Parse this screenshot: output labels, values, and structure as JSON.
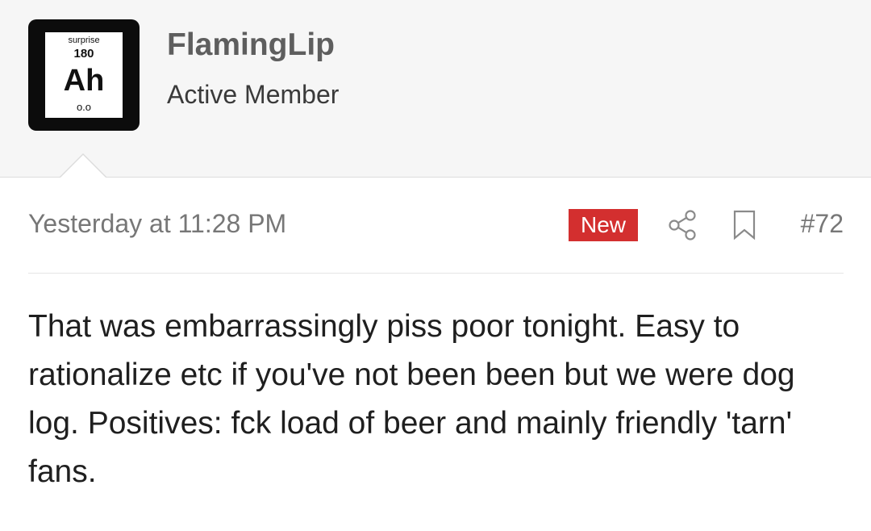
{
  "user": {
    "name": "FlamingLip",
    "title": "Active Member",
    "avatar": {
      "element_name": "surprise",
      "element_number": "180",
      "element_symbol": "Ah",
      "element_mass": "o.o"
    }
  },
  "post": {
    "timestamp": "Yesterday at 11:28 PM",
    "badge": "New",
    "number": "#72",
    "body": "That was embarrassingly piss poor tonight. Easy to rationalize etc if you've not been been but we were dog log. Positives: fck load of beer and mainly friendly 'tarn' fans."
  },
  "icons": {
    "share": "share-icon",
    "bookmark": "bookmark-icon"
  },
  "colors": {
    "header_bg": "#f6f6f6",
    "badge_bg": "#d32f2f",
    "muted_text": "#777777",
    "username": "#5e5e5e"
  }
}
